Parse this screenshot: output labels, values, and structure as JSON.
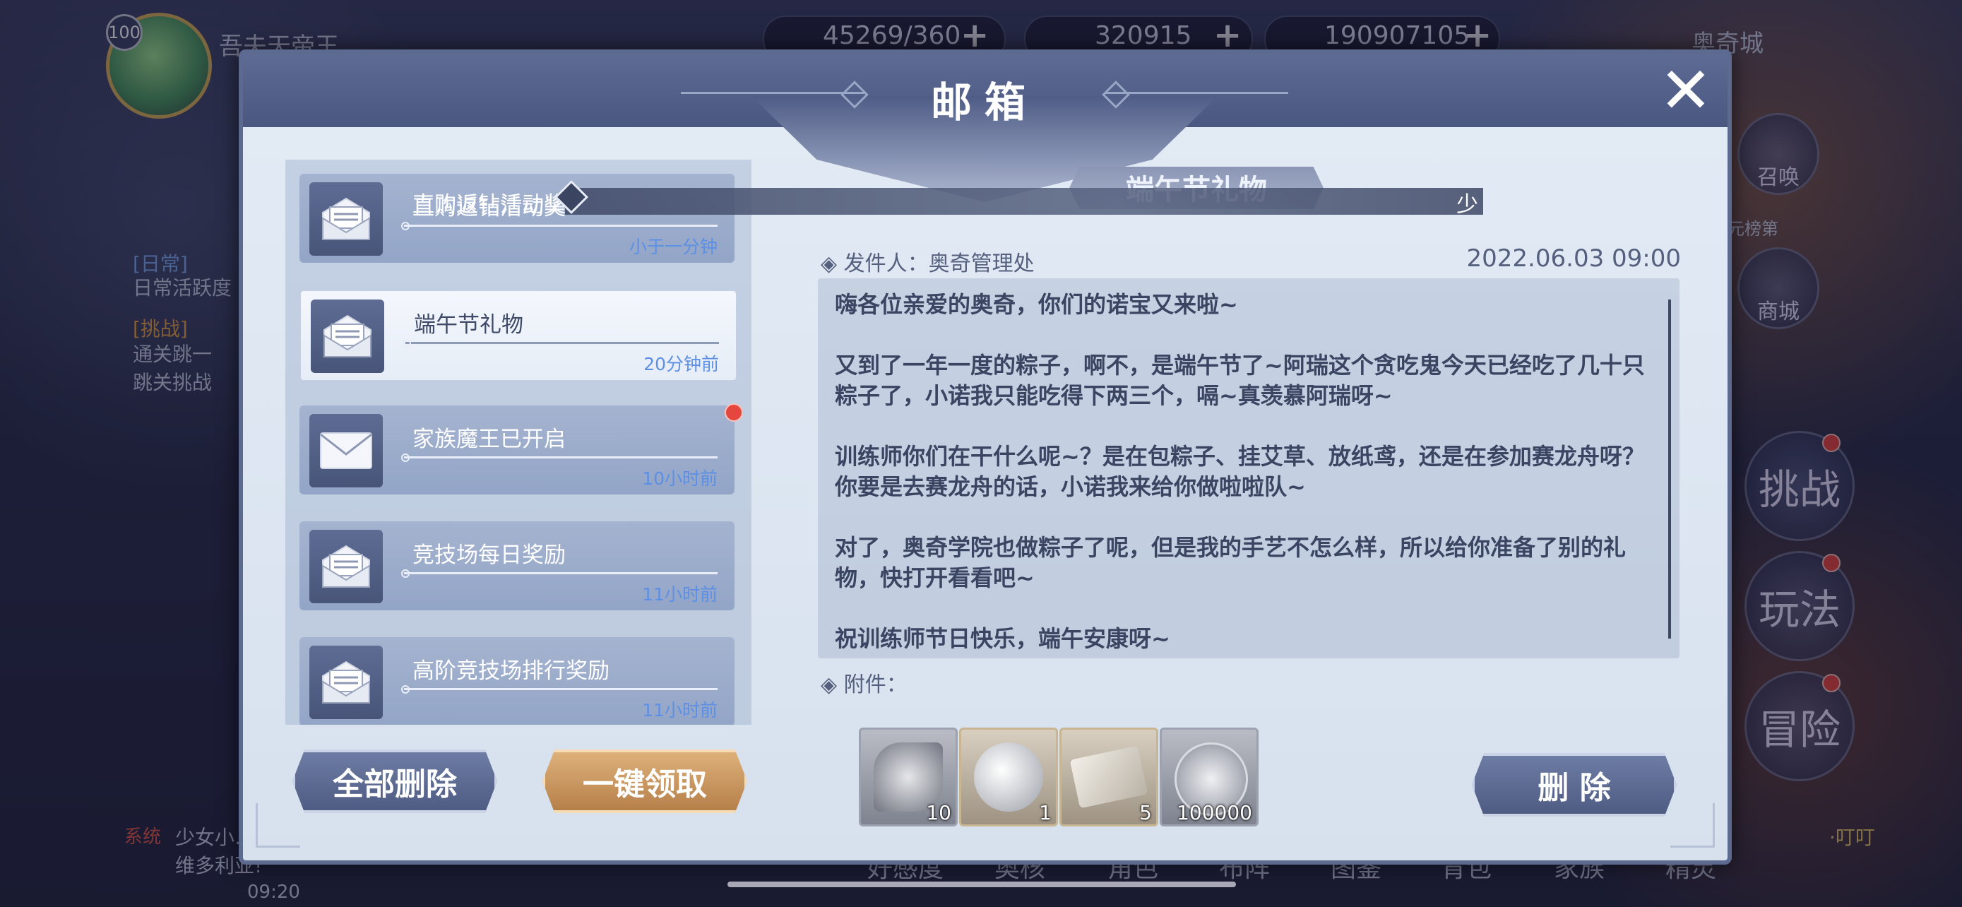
{
  "hud": {
    "player_level": "100",
    "player_name": "吾夫天帝王",
    "resources": [
      {
        "value": "45269/360",
        "plus": "+"
      },
      {
        "value": "320915",
        "plus": "+"
      },
      {
        "value": "190907105",
        "plus": "+"
      }
    ],
    "city_label": "奥奇城",
    "side_buttons": [
      "召唤",
      "商城",
      "挑战",
      "玩法",
      "冒险"
    ],
    "side_small_label": "元榜第",
    "left_tasks": [
      {
        "tag": "[日常]",
        "text": "日常活跃度"
      },
      {
        "tag": "[挑战]",
        "text": "通关跳一跳关挑战"
      }
    ],
    "chat": {
      "channel": "系统",
      "text": "少女小…隐刺·维多利亚!",
      "time": "09:20"
    },
    "bottom_tabs": [
      "好感度",
      "奥核",
      "角色",
      "布阵",
      "图鉴",
      "背包",
      "家族",
      "精灵"
    ],
    "chat_right": "·叮叮"
  },
  "marquee": {
    "text": "直购返钻活动奖",
    "tail": "少"
  },
  "dialog": {
    "title": "邮箱",
    "close_icon": "close-icon",
    "mails": [
      {
        "title": "直购返钻活动奖",
        "time": "小于一分钟",
        "icon": "open-envelope-icon",
        "unread": false
      },
      {
        "title": "端午节礼物",
        "time": "20分钟前",
        "icon": "open-envelope-icon",
        "unread": false,
        "selected": true
      },
      {
        "title": "家族魔王已开启",
        "time": "10小时前",
        "icon": "closed-envelope-icon",
        "unread": true
      },
      {
        "title": "竞技场每日奖励",
        "time": "11小时前",
        "icon": "open-envelope-icon",
        "unread": false
      },
      {
        "title": "高阶竞技场排行奖励",
        "time": "11小时前",
        "icon": "open-envelope-icon",
        "unread": false
      }
    ],
    "delete_all_label": "全部删除",
    "claim_all_label": "一键领取",
    "detail": {
      "subject": "端午节礼物",
      "sender": "◈ 发件人：奥奇管理处",
      "date": "2022.06.03  09:00",
      "body": "嗨各位亲爱的奥奇，你们的诺宝又来啦~\n\n又到了一年一度的粽子，啊不，是端午节了~阿瑞这个贪吃鬼今天已经吃了几十只粽子了，小诺我只能吃得下两三个，嗝~真羡慕阿瑞呀~\n\n训练师你们在干什么呢~？是在包粽子、挂艾草、放纸鸢，还是在参加赛龙舟呀？你要是去赛龙舟的话，小诺我来给你做啦啦队~\n\n对了，奥奇学院也做粽子了呢，但是我的手艺不怎么样，所以给你准备了别的礼物，快打开看看吧~\n\n祝训练师节日快乐，端午安康呀~",
      "attach_label": "◈ 附件：",
      "attachments": [
        {
          "count": "10",
          "icon": "dragon-emblem-icon"
        },
        {
          "count": "1",
          "icon": "spirit-pet-icon"
        },
        {
          "count": "5",
          "icon": "ticket-icon"
        },
        {
          "count": "100000",
          "icon": "silver-coin-icon"
        }
      ],
      "delete_label": "删 除"
    }
  }
}
